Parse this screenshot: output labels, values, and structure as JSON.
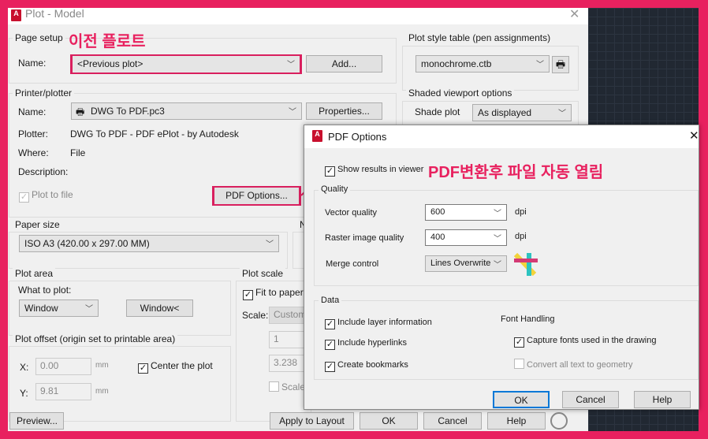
{
  "plot_dialog": {
    "title": "Plot - Model",
    "page_setup": {
      "label": "Page setup",
      "name_label": "Name:",
      "name_value": "<Previous plot>",
      "add_button": "Add...",
      "annotation": "이전 플로트"
    },
    "printer": {
      "label": "Printer/plotter",
      "name_label": "Name:",
      "name_value": "DWG To PDF.pc3",
      "properties_button": "Properties...",
      "plotter_label": "Plotter:",
      "plotter_value": "DWG To PDF - PDF ePlot - by Autodesk",
      "where_label": "Where:",
      "where_value": "File",
      "description_label": "Description:",
      "plot_to_file": "Plot to file",
      "plot_to_file_checked": true,
      "pdf_options_button": "PDF Options..."
    },
    "plot_style": {
      "label": "Plot style table (pen assignments)",
      "value": "monochrome.ctb"
    },
    "shaded": {
      "label": "Shaded viewport options",
      "shade_plot_label": "Shade plot",
      "shade_plot_value": "As displayed"
    },
    "paper_size": {
      "label": "Paper size",
      "value": "ISO A3 (420.00 x 297.00 MM)",
      "partial_label": "N"
    },
    "plot_area": {
      "label": "Plot area",
      "what_label": "What to plot:",
      "what_value": "Window",
      "window_button": "Window<"
    },
    "plot_offset": {
      "label": "Plot offset (origin set to printable area)",
      "x_label": "X:",
      "x_value": "0.00",
      "y_label": "Y:",
      "y_value": "9.81",
      "unit": "mm",
      "center_label": "Center the plot",
      "center_checked": true
    },
    "plot_scale": {
      "label": "Plot scale",
      "fit_label": "Fit to paper",
      "fit_checked": true,
      "scale_label": "Scale:",
      "scale_value": "Custom",
      "v1": "1",
      "v2": "3.238",
      "scale_lw": "Scale l"
    },
    "buttons": {
      "preview": "Preview...",
      "apply": "Apply to Layout",
      "ok": "OK",
      "cancel": "Cancel",
      "help": "Help"
    }
  },
  "pdf_dialog": {
    "title": "PDF Options",
    "show_results": "Show results in viewer",
    "show_results_checked": true,
    "annotation": "PDF변환후 파일 자동 열림",
    "quality": {
      "label": "Quality",
      "vector_label": "Vector quality",
      "vector_value": "600",
      "raster_label": "Raster image quality",
      "raster_value": "400",
      "unit": "dpi",
      "merge_label": "Merge control",
      "merge_value": "Lines Overwrite"
    },
    "data": {
      "label": "Data",
      "layer": "Include layer information",
      "hyperlinks": "Include hyperlinks",
      "bookmarks": "Create bookmarks",
      "font_label": "Font Handling",
      "capture": "Capture fonts used in the drawing",
      "convert": "Convert all text to geometry",
      "layer_checked": true,
      "hyperlinks_checked": true,
      "bookmarks_checked": true,
      "capture_checked": true,
      "convert_checked": false
    },
    "buttons": {
      "ok": "OK",
      "cancel": "Cancel",
      "help": "Help"
    }
  },
  "colors": {
    "highlight": "#e8215f",
    "canvas": "#212832",
    "accent": "#0078d7"
  }
}
